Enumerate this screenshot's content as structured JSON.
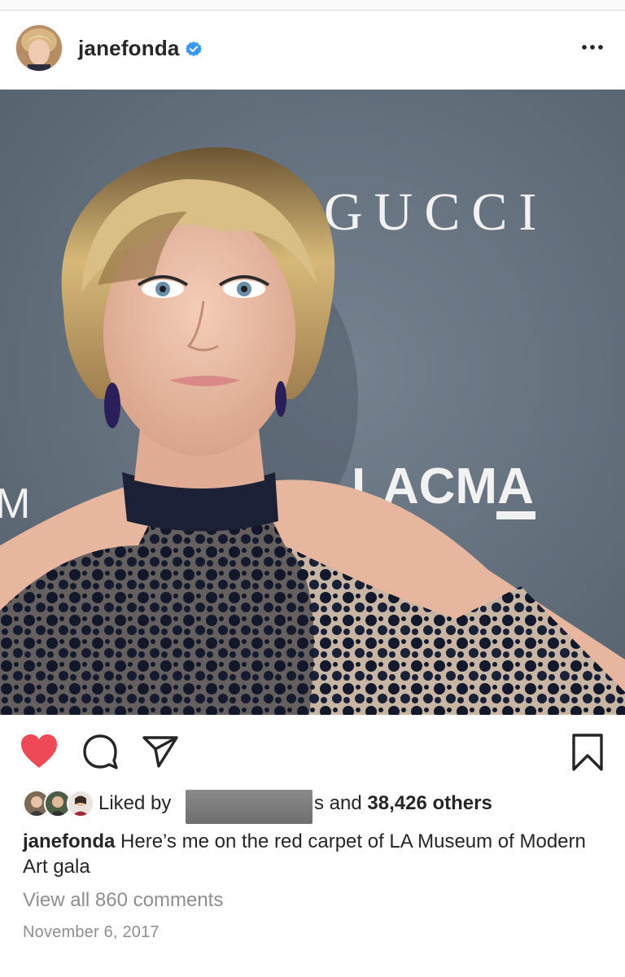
{
  "post": {
    "username": "janefonda",
    "verified": true,
    "photo": {
      "backdrop_words": [
        "GUCCI",
        "LACMA",
        "M"
      ],
      "backdrop_color": "#5e6a78"
    },
    "likes": {
      "prefix": "Liked by",
      "redacted_tail": "s",
      "suffix_and": "and",
      "count_text": "38,426 others"
    },
    "caption": {
      "username": "janefonda",
      "text": "Here’s me on the red carpet of LA Museum of Modern Art gala"
    },
    "comments_link": "View all 860 comments",
    "date": "November 6, 2017"
  },
  "icons": {
    "like": "heart-icon",
    "comment": "comment-bubble-icon",
    "share": "paper-plane-icon",
    "save": "bookmark-icon",
    "more": "ellipsis-icon",
    "verified": "verified-badge-icon"
  },
  "colors": {
    "like_red": "#ed4956",
    "verified_blue": "#3897f0",
    "muted": "#8e8e8e",
    "text": "#262626"
  }
}
